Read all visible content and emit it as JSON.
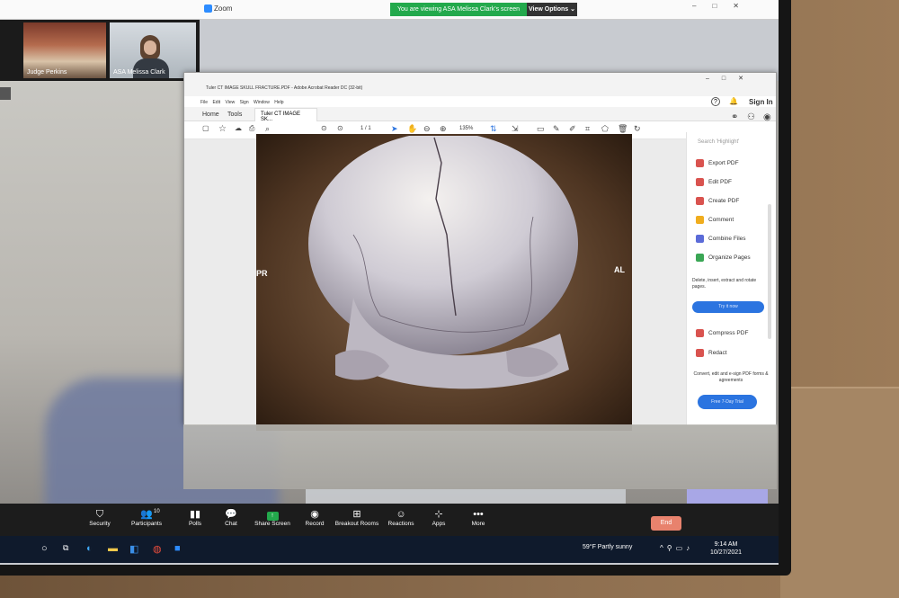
{
  "zoom": {
    "window_title": "Zoom",
    "viewing_banner": "You are viewing ASA Melissa Clark's screen",
    "view_options": "View Options ⌄",
    "gallery": [
      {
        "name": "Judge Perkins"
      },
      {
        "name": "ASA Melissa Clark"
      }
    ],
    "toolbar": [
      {
        "label": "Security",
        "icon": "shield-icon"
      },
      {
        "label": "Participants",
        "icon": "people-icon"
      },
      {
        "label": "Polls",
        "icon": "polls-icon"
      },
      {
        "label": "Chat",
        "icon": "chat-icon"
      },
      {
        "label": "Share Screen",
        "icon": "share-screen-icon"
      },
      {
        "label": "Record",
        "icon": "record-icon"
      },
      {
        "label": "Breakout Rooms",
        "icon": "breakout-rooms-icon"
      },
      {
        "label": "Reactions",
        "icon": "reactions-icon"
      },
      {
        "label": "Apps",
        "icon": "apps-icon"
      },
      {
        "label": "More",
        "icon": "more-icon"
      }
    ],
    "participants_count": "10",
    "end_label": "End"
  },
  "acrobat": {
    "title": "Tuler CT IMAGE SKULL FRACTURE.PDF - Adobe Acrobat Reader DC (32-bit)",
    "menu": [
      "File",
      "Edit",
      "View",
      "Sign",
      "Window",
      "Help"
    ],
    "tabs": {
      "home": "Home",
      "tools": "Tools",
      "document": "Tuler CT IMAGE SK..."
    },
    "sign_in": "Sign In",
    "page_current": "1",
    "page_total": "/ 1",
    "zoom_level": "135%",
    "image_labels": {
      "left": "PR",
      "right": "AL"
    },
    "right_pane": {
      "search": "Search 'Highlight'",
      "items": [
        {
          "label": "Export PDF",
          "icon": "export-pdf-icon",
          "color": "#d9534f"
        },
        {
          "label": "Edit PDF",
          "icon": "edit-pdf-icon",
          "color": "#d9534f"
        },
        {
          "label": "Create PDF",
          "icon": "create-pdf-icon",
          "color": "#d9534f"
        },
        {
          "label": "Comment",
          "icon": "comment-icon",
          "color": "#f0ad1e"
        },
        {
          "label": "Combine Files",
          "icon": "combine-files-icon",
          "color": "#5b6bd8"
        },
        {
          "label": "Organize Pages",
          "icon": "organize-pages-icon",
          "color": "#3aa655"
        },
        {
          "label": "Compress PDF",
          "icon": "compress-pdf-icon",
          "color": "#d9534f"
        },
        {
          "label": "Redact",
          "icon": "redact-icon",
          "color": "#d9534f"
        }
      ],
      "organize_desc": "Delete, insert, extract and rotate pages.",
      "try_now": "Try it now",
      "convert_desc": "Convert, edit and e-sign PDF forms & agreements",
      "free_trial": "Free 7-Day Trial"
    }
  },
  "taskbar": {
    "weather": "59°F  Partly sunny",
    "time": "9:14 AM",
    "date": "10/27/2021"
  }
}
